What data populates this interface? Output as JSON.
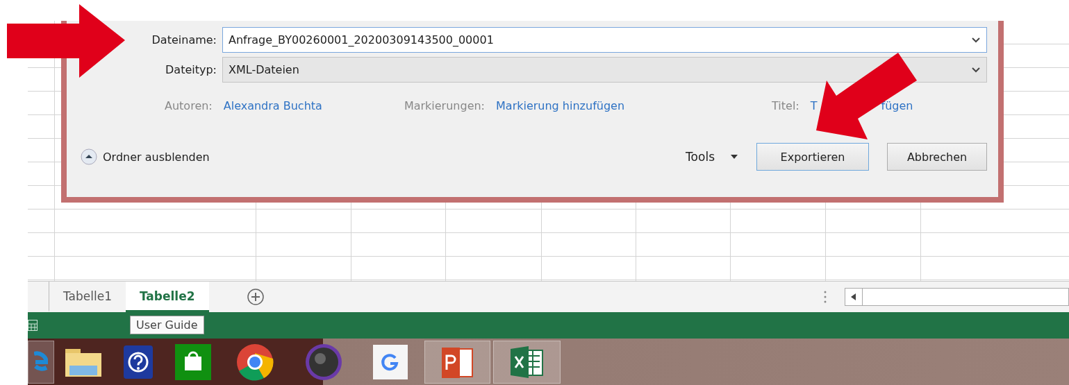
{
  "dialog": {
    "fields": [
      {
        "label": "Dateiname:",
        "value": "Anfrage_BY00260001_20200309143500_00001",
        "kind": "input"
      },
      {
        "label": "Dateityp:",
        "value": "XML-Dateien",
        "kind": "select"
      }
    ],
    "meta": [
      {
        "label": "Autoren:",
        "link_parts": [
          "Alexandra Buchta"
        ]
      },
      {
        "label": "Markierungen:",
        "link_parts": [
          "Markierung hinzufügen"
        ]
      },
      {
        "label": "Titel:",
        "link_parts": [
          "T",
          "fügen"
        ]
      }
    ],
    "folder_toggle": "Ordner ausblenden",
    "tools": "Tools",
    "buttons": [
      {
        "label": "Exportieren",
        "default": true
      },
      {
        "label": "Abbrechen",
        "default": false
      }
    ]
  },
  "sheet_tabs": [
    {
      "label": "Tabelle1",
      "selected": false
    },
    {
      "label": "Tabelle2",
      "selected": true
    }
  ],
  "tooltip": "User Guide",
  "taskbar": [
    {
      "kind": "browser-e",
      "running": true
    },
    {
      "kind": "folder",
      "running": false
    },
    {
      "kind": "help",
      "running": false
    },
    {
      "kind": "store",
      "running": false
    },
    {
      "kind": "chrome",
      "running": false
    },
    {
      "kind": "dial",
      "running": false
    },
    {
      "kind": "g",
      "running": false
    },
    {
      "kind": "slides",
      "running": true
    },
    {
      "kind": "sheet",
      "running": true
    }
  ]
}
